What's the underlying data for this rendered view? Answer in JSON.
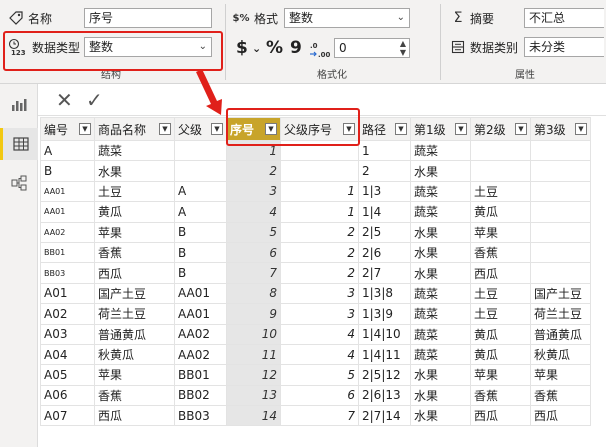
{
  "ribbon": {
    "structure": {
      "name_label": "名称",
      "name_value": "序号",
      "datatype_label": "数据类型",
      "datatype_value": "整数",
      "group_label": "结构"
    },
    "formatting": {
      "format_label": "格式",
      "format_value": "整数",
      "currency_symbol": "$",
      "percent_symbol": "%",
      "comma_symbol": "9",
      "decimals_value": "0",
      "group_label": "格式化"
    },
    "properties": {
      "summarize_label": "摘要",
      "summarize_value": "不汇总",
      "category_label": "数据类别",
      "category_value": "未分类",
      "group_label": "属性"
    }
  },
  "formula_bar": {
    "cancel_symbol": "✕",
    "commit_symbol": "✓"
  },
  "table": {
    "columns": [
      "编号",
      "商品名称",
      "父级",
      "序号",
      "父级序号",
      "路径",
      "第1级",
      "第2级",
      "第3级"
    ],
    "rows": [
      [
        "A",
        "蔬菜",
        "",
        "1",
        "",
        "1",
        "蔬菜",
        "",
        ""
      ],
      [
        "B",
        "水果",
        "",
        "2",
        "",
        "2",
        "水果",
        "",
        ""
      ],
      [
        "AA01",
        "土豆",
        "A",
        "3",
        "1",
        "1|3",
        "蔬菜",
        "土豆",
        ""
      ],
      [
        "AA01",
        "黄瓜",
        "A",
        "4",
        "1",
        "1|4",
        "蔬菜",
        "黄瓜",
        ""
      ],
      [
        "AA02",
        "苹果",
        "B",
        "5",
        "2",
        "2|5",
        "水果",
        "苹果",
        ""
      ],
      [
        "BB01",
        "香蕉",
        "B",
        "6",
        "2",
        "2|6",
        "水果",
        "香蕉",
        ""
      ],
      [
        "BB03",
        "西瓜",
        "B",
        "7",
        "2",
        "2|7",
        "水果",
        "西瓜",
        ""
      ],
      [
        "A01",
        "国产土豆",
        "AA01",
        "8",
        "3",
        "1|3|8",
        "蔬菜",
        "土豆",
        "国产土豆"
      ],
      [
        "A02",
        "荷兰土豆",
        "AA01",
        "9",
        "3",
        "1|3|9",
        "蔬菜",
        "土豆",
        "荷兰土豆"
      ],
      [
        "A03",
        "普通黄瓜",
        "AA02",
        "10",
        "4",
        "1|4|10",
        "蔬菜",
        "黄瓜",
        "普通黄瓜"
      ],
      [
        "A04",
        "秋黄瓜",
        "AA02",
        "11",
        "4",
        "1|4|11",
        "蔬菜",
        "黄瓜",
        "秋黄瓜"
      ],
      [
        "A05",
        "苹果",
        "BB01",
        "12",
        "5",
        "2|5|12",
        "水果",
        "苹果",
        "苹果"
      ],
      [
        "A06",
        "香蕉",
        "BB02",
        "13",
        "6",
        "2|6|13",
        "水果",
        "香蕉",
        "香蕉"
      ],
      [
        "A07",
        "西瓜",
        "BB03",
        "14",
        "7",
        "2|7|14",
        "水果",
        "西瓜",
        "西瓜"
      ]
    ],
    "small_code_rows": [
      2,
      3,
      4,
      5,
      6
    ],
    "selected_column": 3,
    "accent_color": "#c8a42a"
  },
  "highlight_color": "#e0201a"
}
